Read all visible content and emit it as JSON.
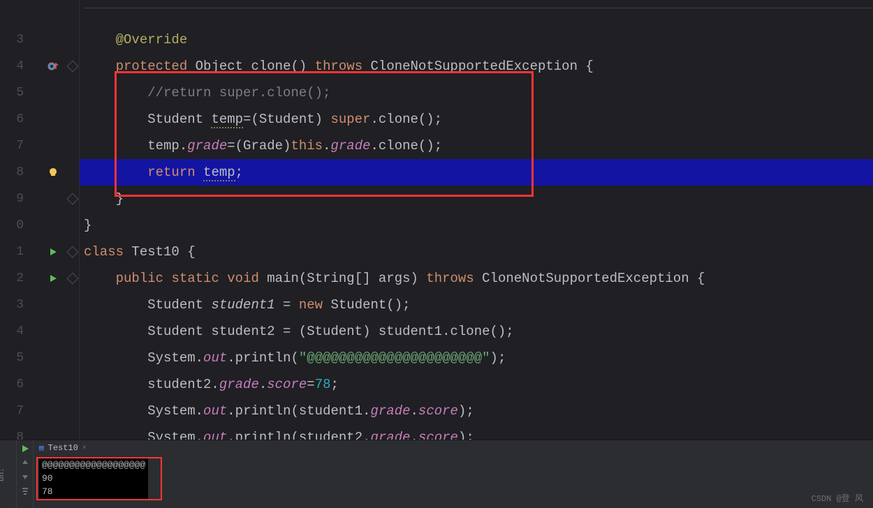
{
  "gutter": {
    "lines": [
      "",
      "3",
      "4",
      "5",
      "6",
      "7",
      "8",
      "9",
      "0",
      "1",
      "2",
      "3",
      "4",
      "5",
      "6",
      "7",
      "8"
    ],
    "iconAt": {
      "2": "breakpoint-overlay",
      "7": "bulb",
      "10": "play",
      "11": "play"
    },
    "foldAt": {
      "2": "diamond-open",
      "8": "diamond",
      "10": "diamond-open",
      "11": "diamond-open"
    }
  },
  "code": {
    "l1_annotation": "@Override",
    "l2": {
      "kw1": "protected ",
      "type": "Object ",
      "name": "clone",
      "paren": "() ",
      "throws": "throws ",
      "exc": "CloneNotSupportedException {"
    },
    "l3_comment": "//return super.clone();",
    "l4": {
      "a": "Student ",
      "b": "temp",
      "c": "=(Student) ",
      "sup": "super",
      "d": ".clone();"
    },
    "l5": {
      "a": "temp.",
      "grade": "grade",
      "b": "=(Grade)",
      "this": "this",
      "c": ".",
      "grade2": "grade",
      "d": ".clone();"
    },
    "l6": {
      "ret": "return ",
      "t": "temp",
      "semi": ";"
    },
    "l7_brace": "}",
    "l8_brace": "}",
    "l9": {
      "kw": "class ",
      "name": "Test10 {"
    },
    "l10": {
      "a": "public ",
      "b": "static ",
      "c": "void ",
      "m": "main",
      "p": "(String[] args) ",
      "t": "throws ",
      "e": "CloneNotSupportedException {"
    },
    "l11": {
      "a": "Student ",
      "v": "student1",
      "b": " = ",
      "n": "new ",
      "c": "Student();"
    },
    "l12": {
      "a": "Student student2 = (Student) student1.clone();"
    },
    "l13": {
      "a": "System.",
      "o": "out",
      "b": ".println(",
      "s": "\"@@@@@@@@@@@@@@@@@@@@@@\"",
      "c": ");"
    },
    "l14": {
      "a": "student2.",
      "g": "grade",
      "b": ".",
      "sc": "score",
      "c": "=",
      "n": "78",
      "d": ";"
    },
    "l15": {
      "a": "System.",
      "o": "out",
      "b": ".println(student1.",
      "g": "grade",
      "c": ".",
      "sc": "score",
      "d": ");"
    },
    "l16": {
      "a": "System.",
      "o": "out",
      "b": ".println(student2.",
      "g": "grade",
      "c": ".",
      "sc": "score",
      "d": ");"
    }
  },
  "run": {
    "label": "un:",
    "tabName": "Test10",
    "tabClose": "×",
    "console": [
      "@@@@@@@@@@@@@@@@@@@",
      "90",
      "78"
    ]
  },
  "watermark": "CSDN @登 风"
}
